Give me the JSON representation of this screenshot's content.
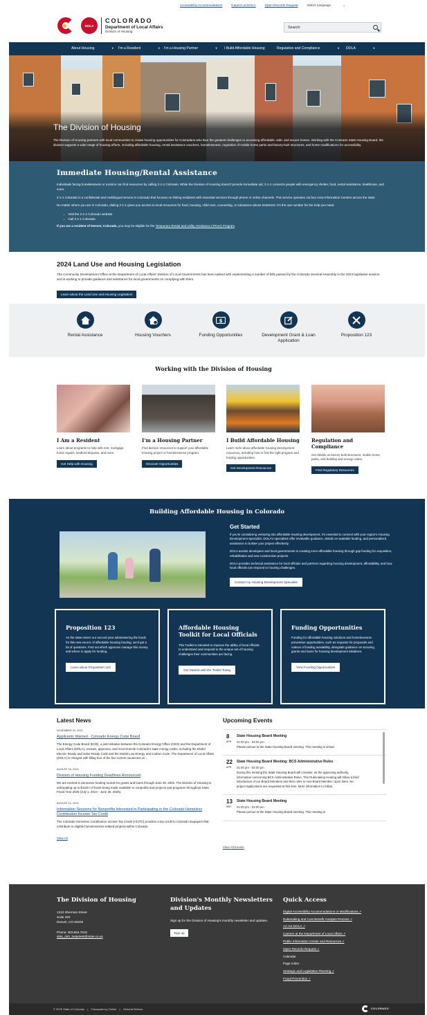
{
  "utility": {
    "links": [
      "Accessibility Accommodations",
      "Careers at DOLA",
      "Open Records Request"
    ],
    "language": "Select Language"
  },
  "logo": {
    "seal_text": "DOLA",
    "line1": "COLORADO",
    "line2": "Department of Local Affairs",
    "line3": "Division of Housing"
  },
  "search": {
    "placeholder": "Search"
  },
  "nav": [
    "About Housing",
    "I'm a Resident",
    "I'm a Housing Partner",
    "I Build Affordable Housing",
    "Regulation and Compliance",
    "DOLA"
  ],
  "hero": {
    "title": "The Division of Housing",
    "text": "The Division of Housing partners with local communities to create housing opportunities for Coloradans who face the greatest challenges to accessing affordable, safe, and secure homes. Working with the Colorado State Housing Board, the division supports a wide range of housing efforts, including affordable housing, rental assistance vouchers, homelessness, regulation of mobile home parks and factory-built structures, and home modifications for accessibility."
  },
  "immediate": {
    "title": "Immediate Housing/Rental Assistance",
    "p1": "Individuals facing homelessness or eviction can find resources by calling 2-1-1 Colorado. While the Division of Housing doesn't provide immediate aid, 2-1-1 connects people with emergency shelter, food, rental assistance, healthcare, and more.",
    "p2": "2-1-1 Colorado is a confidential and multilingual service in Colorado that focuses on linking residents with essential services through phone or online channels. This service operates via four Area Information Centers across the state.",
    "p3": "No matter where you are in Colorado, dialing 2-1-1 gives you access to local resources for food, housing, child care, counseling, or substance abuse treatment. It's the one number for the help you need.",
    "bullet1": "Visit the 2-1-1 Colorado website.",
    "bullet2": "Call 2-1-1 Colorado.",
    "denver_bold": "If you are a resident of Denver, Colorado,",
    "denver_rest": " you may be eligible for the ",
    "denver_link": "Temporary Rental and Utility Assistance (TRUA) Program",
    "denver_end": "."
  },
  "legislation": {
    "title": "2024 Land Use and Housing Legislation",
    "text": "The Community Development Office at the Department of Local Affairs' Division of Local Governments has been tasked with implementing a number of bills passed by the Colorado General Assembly in the 2024 legislative session and is working to provide guidance and assistance for local governments on complying with them.",
    "button": "Learn about the Land Use and Housing Legislation"
  },
  "quick_icons": [
    {
      "label": "Rental Assistance",
      "icon": "home-icon"
    },
    {
      "label": "Housing Vouchers",
      "icon": "house-check-icon"
    },
    {
      "label": "Funding Opportunities",
      "icon": "money-icon"
    },
    {
      "label": "Development Grant & Loan Application",
      "icon": "edit-icon"
    },
    {
      "label": "Proposition 123",
      "icon": "tools-icon"
    }
  ],
  "working": {
    "title": "Working with the Division of Housing",
    "cards": [
      {
        "title": "I Am a Resident",
        "text": "Learn about programs to help with rent, mortgage, home repairs, landlord disputes, and more.",
        "button": "Get Help with Housing"
      },
      {
        "title": "I'm a Housing Partner",
        "text": "Find division resources to support your affordable housing project or homelessness program.",
        "button": "Discover Opportunities"
      },
      {
        "title": "I Build Affordable Housing",
        "text": "Learn more about affordable housing development resources, including how to find the right program and funding opportunities.",
        "button": "Get Development Resources"
      },
      {
        "title": "Regulation and Compliance",
        "text": "Get details on factory built structures, mobile home parks, and building and energy codes.",
        "button": "Find Regulatory Resources"
      }
    ]
  },
  "building": {
    "title": "Building Affordable Housing in Colorado",
    "gs_title": "Get Started",
    "gs_p1": "If you're considering venturing into affordable housing development, it's essential to connect with your region's Housing Development Specialist. DOLA's specialists offer invaluable guidance, details on available funding, and personalized assistance to bolster your project effectively.",
    "gs_p2": "DOLA assists developers and local governments in creating more affordable housing through gap funding for acquisition, rehabilitation and new construction projects.",
    "gs_p3": "DOLA provides technical assistance for local officials and partners regarding housing development, affordability, and how local officials can respond to housing challenges.",
    "gs_button": "Contact my Housing Development Specialist",
    "boxes": [
      {
        "title": "Proposition 123",
        "text": "As the state enters our second year administering the funds for this new source of affordable housing funding, we'd get a lot of questions. Find out which agencies manage this money and where to apply for funding.",
        "button": "Learn about Proposition 123"
      },
      {
        "title": "Affordable Housing Toolkit for Local Officials",
        "text": "This Toolkit is intended to improve the ability of local officials to understand and respond to the unique set of housing challenges their communities are facing.",
        "button": "Get Started with the Toolkit Today"
      },
      {
        "title": "Funding Opportunities",
        "text": "Funding for affordable housing solutions and homelessness prevention opportunities, such as requests for proposals and notices of funding availability, alongside guidance on securing grants and loans for housing development initiatives.",
        "button": "View Funding Opportunities"
      }
    ]
  },
  "news": {
    "title": "Latest News",
    "items": [
      {
        "date": "NOVEMBER 20, 2024",
        "title": "Applicants Wanted - Colorado Energy Code Board",
        "body": "The Energy Code Board (ECB), a joint initiative between the Colorado Energy Office (CEO) and the Department of Local Affairs (DOLA), reviews, approves, and recommends Colorado's state energy codes, including the Model Electric Ready and Solar Ready Code and the Model Low Energy and Carbon Code. The Department of Local Affairs (DOLA) is charged with filling four of the five current vacancies on..."
      },
      {
        "date": "AUGUST 16, 2024",
        "title": "Division of Housing Funding Deadlines Announced",
        "body": "We are excited to announce funding rounds for grants and loans through June 30, 2025. The Division of Housing is anticipating up to $134m of funds being made available to nonprofits and projects and programs throughout State Fiscal Year 2025 (July 1, 2024 - June 30, 2025)."
      },
      {
        "date": "AUGUST 12, 2024",
        "title": "Information Sessions for Nonprofits Interested in Participating in the Colorado Homeless Contribution Income Tax Credit",
        "body": "The Colorado Homeless Contribution Income Tax Credit (HCITC) provides a tax credit to Colorado taxpayers that contribute to eligible homelessness-related projects within Colorado."
      }
    ],
    "view_all": "View All"
  },
  "events": {
    "title": "Upcoming Events",
    "items": [
      {
        "day": "8",
        "month": "APR",
        "title": "State Housing Board Meeting",
        "time": "01:00 pm - 03:00 pm",
        "desc": "Please pursue to the State Housing Board meeting. This meeting is virtual."
      },
      {
        "day": "22",
        "month": "APR",
        "title": "State Housing Board Meeting: BCS Administrative Rules",
        "time": "01:00 pm - 02:00 pm",
        "desc": "During this meeting the State Housing Board will consider, as the approving authority, information concerning BCS Administrative Rules. This Rulemaking Hearing will follow a brief introduction of our Board Members and their roles to new Board Member. Upon timer. No project applications are requested at this time. More information to follow."
      },
      {
        "day": "13",
        "month": "MAY",
        "title": "State Housing Board Meeting",
        "time": "01:00 pm - 03:00 pm",
        "desc": "Please pursue to the State Housing Board meeting. This meeting is"
      }
    ],
    "view_all": "View All Events"
  },
  "footer": {
    "col1_title": "The Division of Housing",
    "address1": "1313 Sherman Street",
    "address2": "Suite 320",
    "address3": "Denver, CO 80203",
    "phone": "Phone: 303.864.7810",
    "email": "dola_doh_helpdesk@state.co.us",
    "col2_title": "Division's Monthly Newsletters and Updates",
    "col2_text": "Sign up for the Division of Housing's monthly newsletter and updates.",
    "signup": "Sign up",
    "col3_title": "Quick Access",
    "links": [
      {
        "label": "Digital Accessibility Accommodations or Modifications",
        "ext": true
      },
      {
        "label": "Rulemaking and Cost Benefit Analysis Process",
        "ext": true
      },
      {
        "label": "AA Act DOLA",
        "ext": true
      },
      {
        "label": "Careers at the Department of Local Affairs",
        "ext": true
      },
      {
        "label": "Public Information Center and Resources",
        "ext": true
      },
      {
        "label": "Open Records Request",
        "ext": true
      },
      {
        "label": "Calendar",
        "ext": false
      },
      {
        "label": "Page Index",
        "ext": false
      },
      {
        "label": "Strategic and Legislative Planning",
        "ext": true
      },
      {
        "label": "Fraud Prevention",
        "ext": true
      }
    ]
  },
  "subfooter": {
    "copyright": "© 2025 State of Colorado",
    "sep": "|",
    "link1": "Transparency Online",
    "link2": "General Notices",
    "logo_text": "COLORADO"
  },
  "colors": {
    "navy": "#123554",
    "teal": "#2e5b73",
    "footer": "#3a3a3a",
    "link": "#1c4f8a",
    "accent_red": "#c8102e"
  }
}
